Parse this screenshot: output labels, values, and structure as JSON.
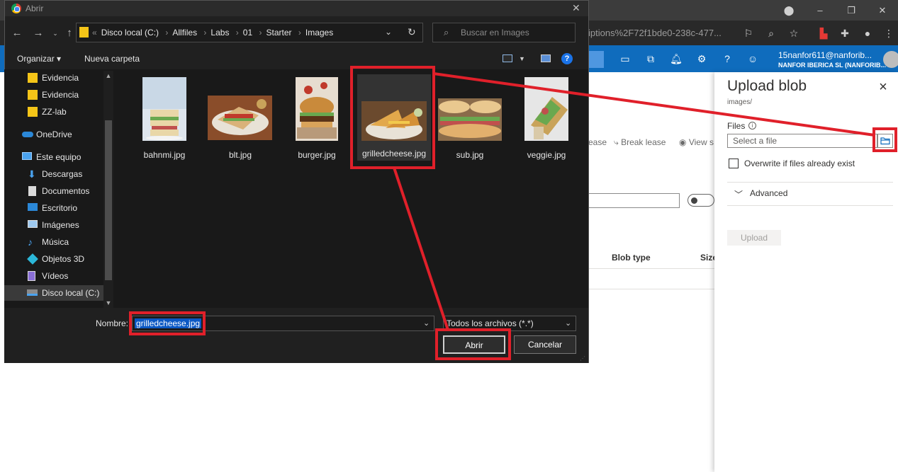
{
  "browser": {
    "url_fragment": "iptions%2F72f1bde0-238c-477...",
    "user_email": "15nanfor611@nanforib...",
    "user_org": "NANFOR IBERICA SL (NANFORIB..."
  },
  "azure": {
    "toolbar": [
      "ease",
      "Break lease",
      "View s"
    ],
    "columns": [
      "Blob type",
      "Size"
    ]
  },
  "upload_panel": {
    "title": "Upload blob",
    "subtitle": "images/",
    "files_label": "Files",
    "file_placeholder": "Select a file",
    "overwrite_label": "Overwrite if files already exist",
    "advanced_label": "Advanced",
    "upload_button": "Upload"
  },
  "dialog": {
    "title": "Abrir",
    "breadcrumbs": [
      "Disco local (C:)",
      "Allfiles",
      "Labs",
      "01",
      "Starter",
      "Images"
    ],
    "search_placeholder": "Buscar en Images",
    "organize_label": "Organizar ▾",
    "new_folder_label": "Nueva carpeta",
    "nav_items": [
      {
        "label": "Evidencia",
        "icon": "folder-icon"
      },
      {
        "label": "Evidencia",
        "icon": "folder-icon"
      },
      {
        "label": "ZZ-lab",
        "icon": "folder-icon"
      },
      {
        "label": "OneDrive",
        "icon": "cloud-icon"
      },
      {
        "label": "Este equipo",
        "icon": "computer-icon"
      },
      {
        "label": "Descargas",
        "icon": "download-icon"
      },
      {
        "label": "Documentos",
        "icon": "document-icon"
      },
      {
        "label": "Escritorio",
        "icon": "desktop-icon"
      },
      {
        "label": "Imágenes",
        "icon": "pictures-icon"
      },
      {
        "label": "Música",
        "icon": "music-icon"
      },
      {
        "label": "Objetos 3D",
        "icon": "cube-icon"
      },
      {
        "label": "Vídeos",
        "icon": "video-icon"
      },
      {
        "label": "Disco local (C:)",
        "icon": "drive-icon"
      }
    ],
    "files": [
      {
        "name": "bahnmi.jpg"
      },
      {
        "name": "blt.jpg"
      },
      {
        "name": "burger.jpg"
      },
      {
        "name": "grilledcheese.jpg"
      },
      {
        "name": "sub.jpg"
      },
      {
        "name": "veggie.jpg"
      }
    ],
    "name_label": "Nombre:",
    "name_value": "grilledcheese.jpg",
    "file_type": "Todos los archivos (*.*)",
    "open_button": "Abrir",
    "cancel_button": "Cancelar"
  },
  "colors": {
    "azure_blue": "#0f6cbd",
    "annotation_red": "#e0202a",
    "dialog_bg": "#202020"
  }
}
